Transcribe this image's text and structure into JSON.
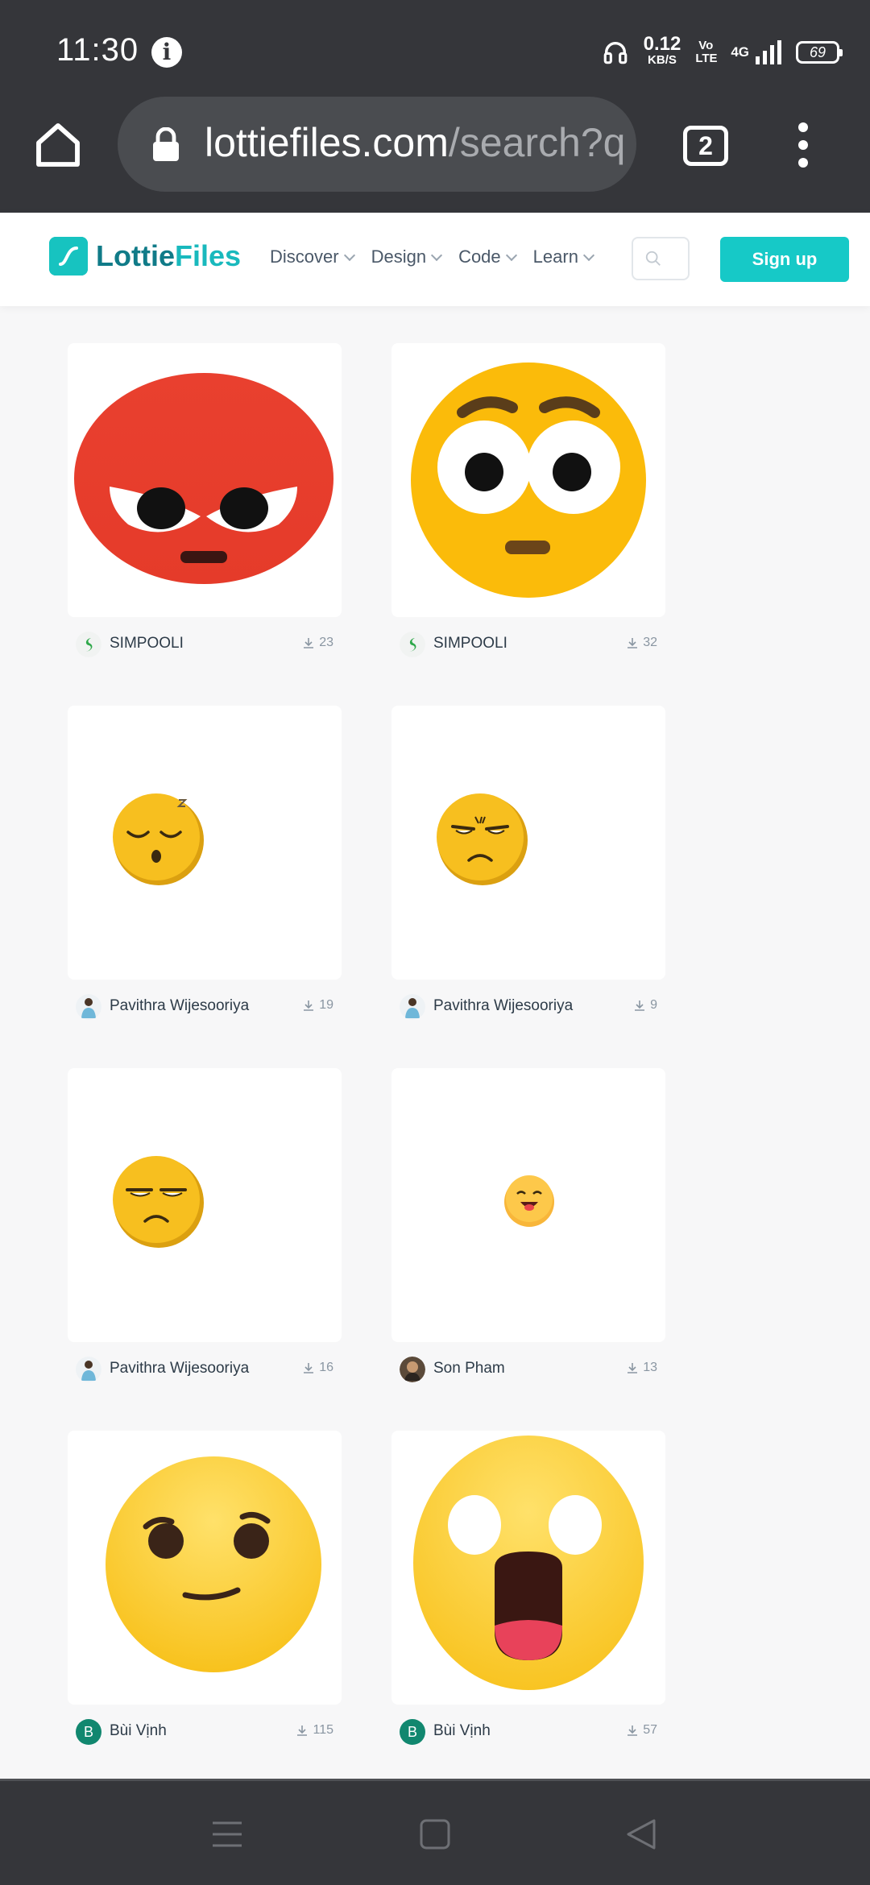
{
  "status_bar": {
    "time": "11:30",
    "net_speed": "0.12",
    "net_unit": "KB/S",
    "volte": "Vo LTE",
    "signal": "4G",
    "battery": "69"
  },
  "browser": {
    "url_host": "lottiefiles.com",
    "url_path": "/search?q",
    "tab_count": "2"
  },
  "site": {
    "logo_main": "Lottie",
    "logo_accent": "Files",
    "nav": [
      "Discover",
      "Design",
      "Code",
      "Learn"
    ],
    "signup_label": "Sign up"
  },
  "results": [
    {
      "author": "SIMPOOLI",
      "downloads": "23",
      "art": "angry-red-face"
    },
    {
      "author": "SIMPOOLI",
      "downloads": "32",
      "art": "shocked-yellow-face"
    },
    {
      "author": "Pavithra Wijesooriya",
      "downloads": "19",
      "art": "sleepy-face"
    },
    {
      "author": "Pavithra Wijesooriya",
      "downloads": "9",
      "art": "frowning-face"
    },
    {
      "author": "Pavithra Wijesooriya",
      "downloads": "16",
      "art": "unamused-face"
    },
    {
      "author": "Son Pham",
      "downloads": "13",
      "art": "tongue-face"
    },
    {
      "author": "Bùi Vịnh",
      "downloads": "115",
      "art": "smirking-face"
    },
    {
      "author": "Bùi Vịnh",
      "downloads": "57",
      "art": "astonished-face"
    }
  ],
  "avatar_letters": {
    "bui_vinh": "B"
  },
  "colors": {
    "brand_teal": "#16c9c7",
    "chrome_dark": "#35363a",
    "emoji_yellow": "#fbbd08",
    "emoji_red": "#e84432"
  }
}
